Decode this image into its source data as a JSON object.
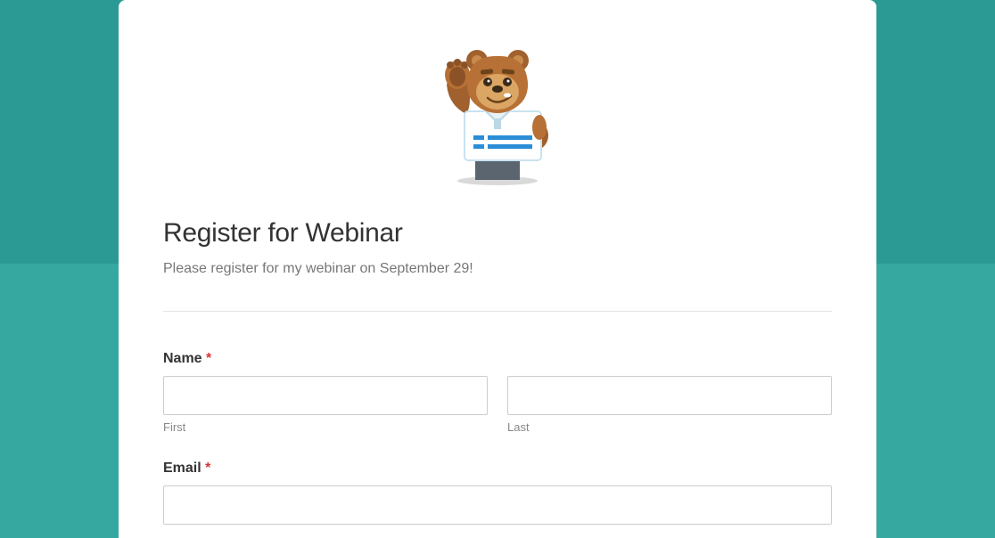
{
  "form": {
    "title": "Register for Webinar",
    "description": "Please register for my webinar on September 29!",
    "fields": {
      "name": {
        "label": "Name",
        "required_mark": "*",
        "first_sublabel": "First",
        "last_sublabel": "Last",
        "first_value": "",
        "last_value": ""
      },
      "email": {
        "label": "Email",
        "required_mark": "*",
        "value": ""
      }
    }
  },
  "mascot": {
    "name": "bear-mascot-waving"
  }
}
